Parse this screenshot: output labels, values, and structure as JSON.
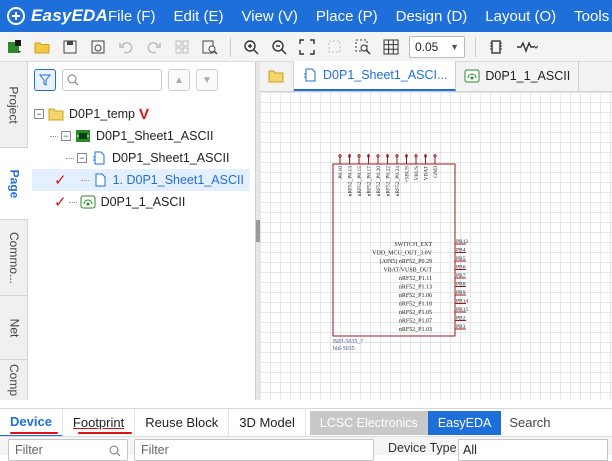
{
  "app": {
    "name": "EasyEDA",
    "menu": [
      "File (F)",
      "Edit (E)",
      "View (V)",
      "Place (P)",
      "Design (D)",
      "Layout (O)",
      "Tools"
    ]
  },
  "toolbar": {
    "zoom": "0.05",
    "icons": [
      "new-icon",
      "open-folder-icon",
      "save-icon",
      "save-as-icon",
      "undo-icon",
      "redo-icon",
      "grid-align-icon",
      "find-icon",
      "zoom-in-icon",
      "zoom-out-icon",
      "fit-icon",
      "select-area-icon",
      "zoom-area-icon",
      "grid-icon",
      "chip-icon",
      "wire-icon"
    ]
  },
  "left_tabs": [
    "Project",
    "Page",
    "Commo...",
    "Net",
    "Comp"
  ],
  "left_tabs_active": "Page",
  "panel": {
    "search_placeholder": "",
    "tree": [
      {
        "label": "D0P1_temp",
        "level": 0,
        "icon": "folder-icon",
        "expander": "−",
        "mark": "V"
      },
      {
        "label": "D0P1_Sheet1_ASCII",
        "level": 1,
        "icon": "schematic-icon",
        "expander": "−",
        "mark": ""
      },
      {
        "label": "D0P1_Sheet1_ASCII",
        "level": 2,
        "icon": "sheet-icon",
        "expander": "−",
        "mark": ""
      },
      {
        "label": "1. D0P1_Sheet1_ASCII",
        "level": 3,
        "icon": "page-icon",
        "expander": "",
        "mark": "✓",
        "selected": true
      },
      {
        "label": "D0P1_1_ASCII",
        "level": 2,
        "icon": "pcb-icon",
        "expander": "",
        "mark": "✓"
      }
    ]
  },
  "doc_tabs": [
    {
      "label": "",
      "icon": "folder-icon"
    },
    {
      "label": "D0P1_Sheet1_ASCI...",
      "icon": "sheet-icon",
      "active": true
    },
    {
      "label": "D0P1_1_ASCII",
      "icon": "pcb-icon"
    }
  ],
  "schematic": {
    "top_pins": [
      "P0.10",
      "nRF52_P0.13",
      "nRF52_P0.15",
      "nRF52_P0.17",
      "nRF52_P0.20",
      "nRF52_P0.22",
      "nRF52_P0.24",
      "+5BUS",
      "VBUS",
      "VBAT",
      "GND"
    ],
    "right_pins": [
      "SWITCH_EXT",
      "VDD_MCU_OUT_3.0V",
      "(AIN5) nRF52_P0.29",
      "VBAT/VUSB_OUT",
      "nRF52_P1.11",
      "nRF52_P1.13",
      "nRF52_P1.06",
      "nRF52_P1.10",
      "nRF52_P1.05",
      "nRF52_P1.07",
      "nRF52_P1.03"
    ],
    "right_nets": [
      "PB12",
      "PB4",
      "PB5",
      "PB6",
      "PB7",
      "PB8",
      "PB9",
      "PB14",
      "PB15",
      "PB2",
      "PB3"
    ],
    "ref": "BID-5035_?",
    "part": "bid-5035"
  },
  "library": {
    "tabs": [
      "Device",
      "Footprint",
      "Reuse Block",
      "3D Model"
    ],
    "sources": [
      "LCSC Electronics",
      "EasyEDA"
    ],
    "search_label": "Search",
    "filter1": "Filter",
    "filter2": "Filter",
    "device_type_label": "Device Type",
    "device_type_value": "All"
  },
  "colors": {
    "accent": "#1e6fd9",
    "annotation": "#e01010",
    "schematic": "#9a1a1a"
  }
}
